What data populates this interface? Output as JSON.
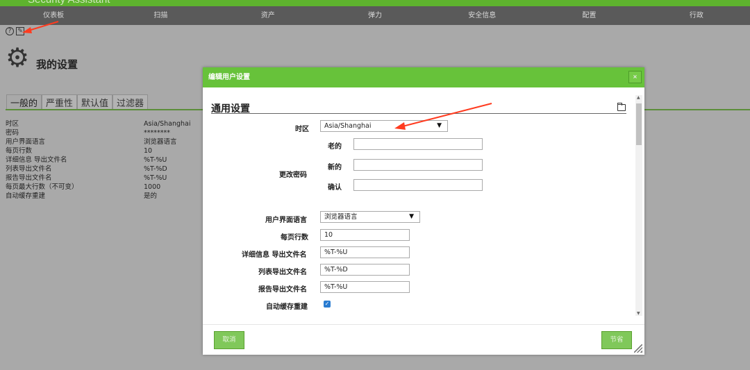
{
  "app": {
    "brand": "Security Assistant"
  },
  "nav": [
    "仪表板",
    "扫描",
    "资产",
    "弹力",
    "安全信息",
    "配置",
    "行政"
  ],
  "page": {
    "title": "我的设置",
    "tabs": [
      "一般的",
      "严重性",
      "默认值",
      "过滤器"
    ],
    "settings": [
      {
        "key": "时区",
        "value": "Asia/Shanghai"
      },
      {
        "key": "密码",
        "value": "********"
      },
      {
        "key": "用户界面语言",
        "value": "浏览器语言"
      },
      {
        "key": "每页行数",
        "value": "10"
      },
      {
        "key": "详细信息 导出文件名",
        "value": "%T-%U"
      },
      {
        "key": "列表导出文件名",
        "value": "%T-%D"
      },
      {
        "key": "报告导出文件名",
        "value": "%T-%U"
      },
      {
        "key": "每页最大行数（不可变）",
        "value": "1000"
      },
      {
        "key": "自动缓存重建",
        "value": "是的"
      }
    ]
  },
  "dialog": {
    "title": "编辑用户设置",
    "close": "×",
    "section_title": "通用设置",
    "timezone": {
      "label": "时区",
      "value": "Asia/Shanghai"
    },
    "change_password": {
      "label": "更改密码",
      "old_label": "老的",
      "old_value": "",
      "new_label": "新的",
      "new_value": "",
      "confirm_label": "确认",
      "confirm_value": ""
    },
    "ui_language": {
      "label": "用户界面语言",
      "value": "浏览器语言"
    },
    "rows_per_page": {
      "label": "每页行数",
      "value": "10"
    },
    "details_export": {
      "label": "详细信息 导出文件名",
      "value": "%T-%U"
    },
    "list_export": {
      "label": "列表导出文件名",
      "value": "%T-%D"
    },
    "report_export": {
      "label": "报告导出文件名",
      "value": "%T-%U"
    },
    "auto_cache": {
      "label": "自动缓存重建",
      "checked": true
    },
    "cancel_label": "取消",
    "save_label": "节省"
  },
  "colors": {
    "accent": "#67c23a",
    "nav_bg": "#5a5a5a",
    "overlay": "#a9a9a9",
    "arrow": "#ff3b1f"
  }
}
